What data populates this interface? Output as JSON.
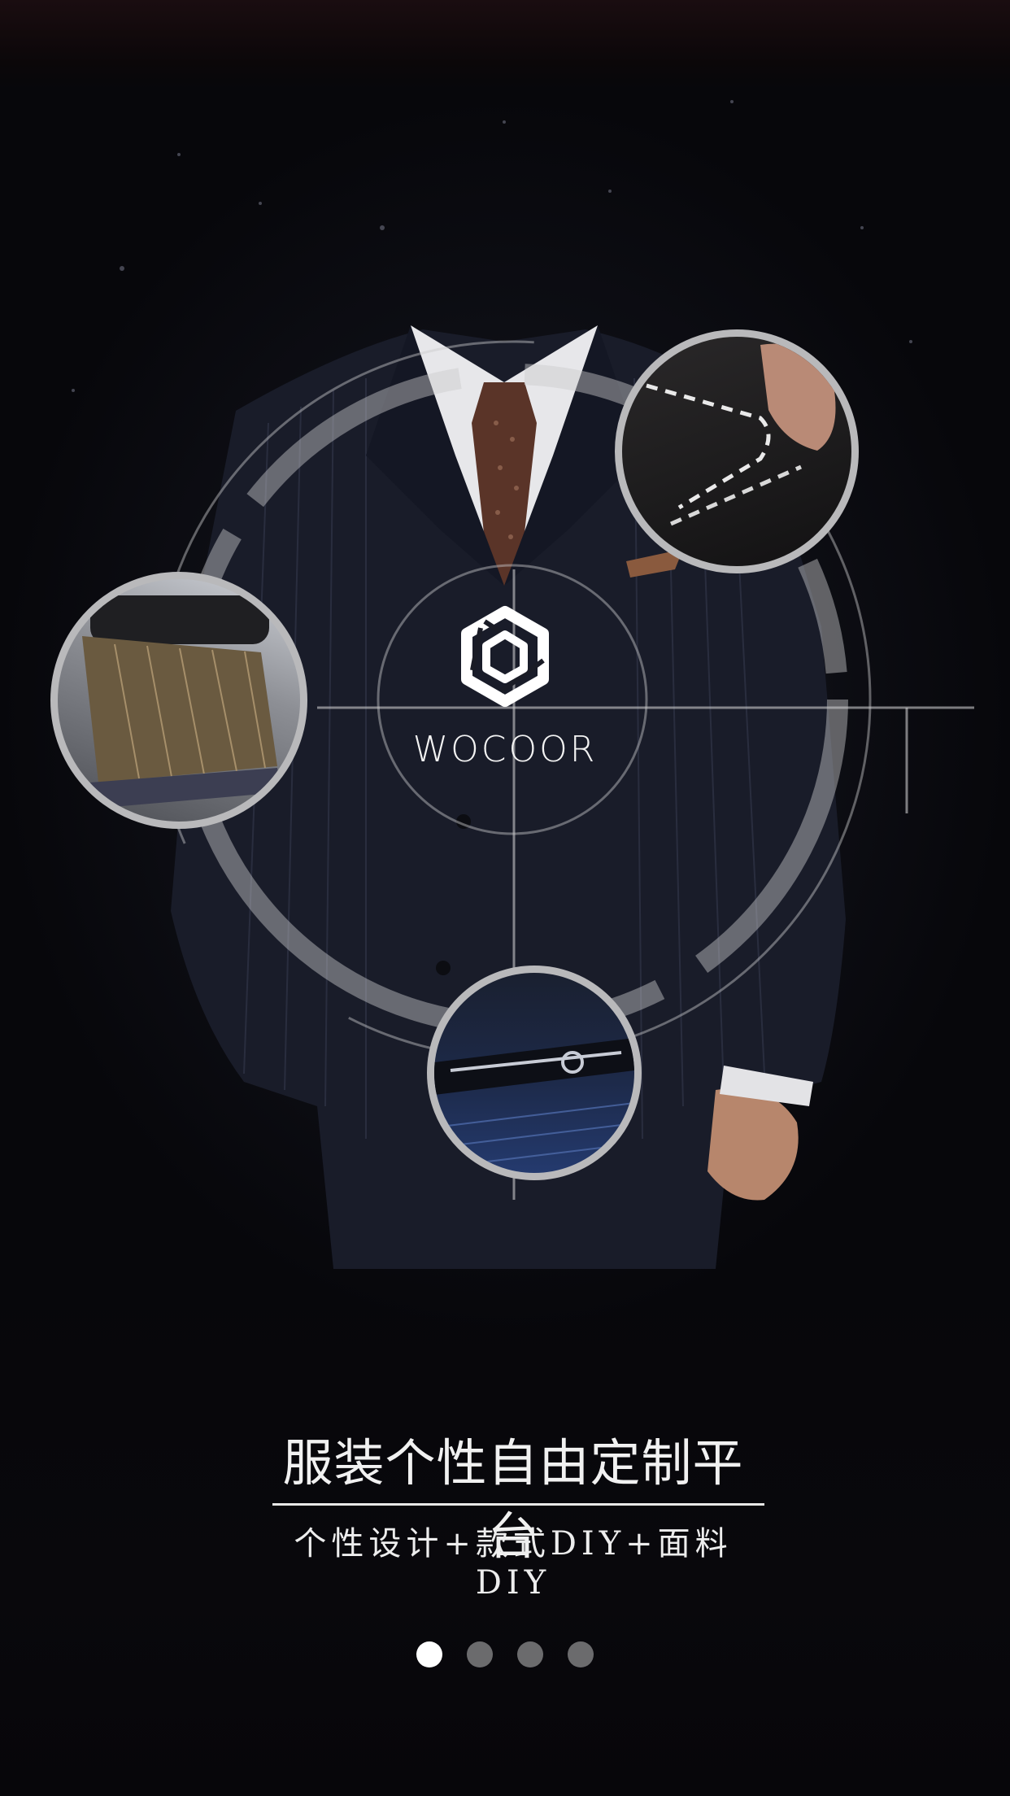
{
  "brand": {
    "name": "WOCOOR",
    "logo_icon": "hexagon-knot-logo"
  },
  "hero": {
    "headline": "服装个性自由定制平台",
    "subline": "个性设计+款式DIY+面料DIY"
  },
  "feature_photos": [
    {
      "name": "hand-stitching-photo"
    },
    {
      "name": "fabric-swatches-photo"
    },
    {
      "name": "tailor-scissors-photo"
    }
  ],
  "pager": {
    "total": 4,
    "current": 1
  },
  "colors": {
    "background": "#07060a",
    "ring": "#b9b9bb",
    "text": "#f1f1f1",
    "dot_active": "#ffffff",
    "dot_inactive": "#6b6b6d"
  }
}
